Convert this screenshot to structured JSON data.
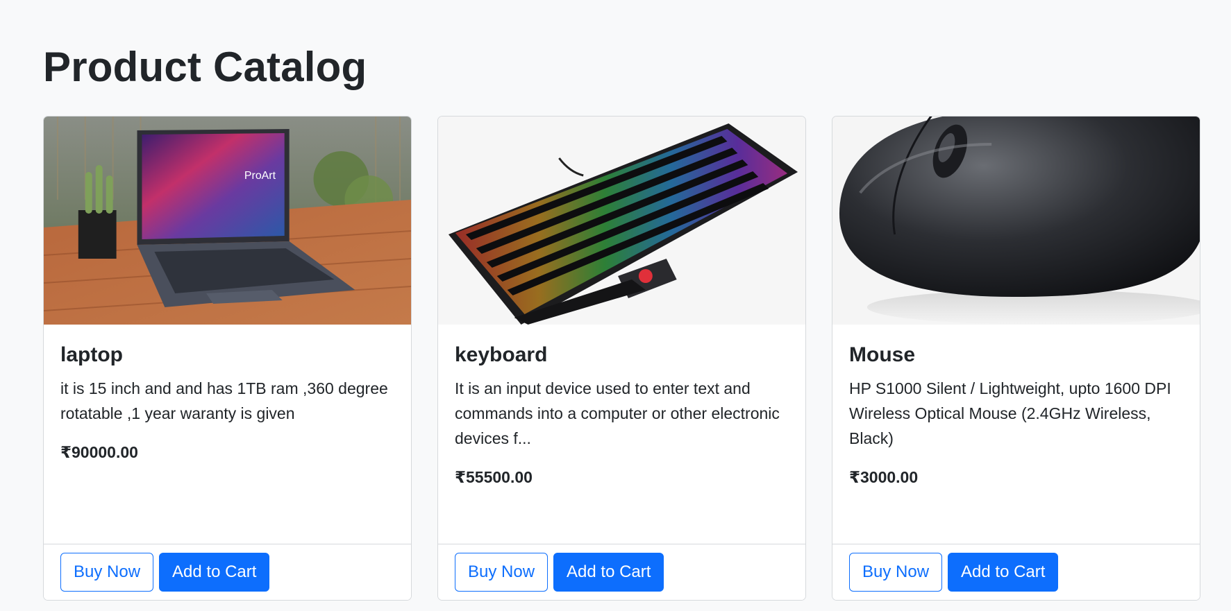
{
  "page": {
    "title": "Product Catalog"
  },
  "colors": {
    "primary": "#0d6efd",
    "background": "#f8f9fa",
    "text": "#212529"
  },
  "products": [
    {
      "name": "laptop",
      "description": "it is 15 inch and and has 1TB ram ,360 degree rotatable ,1 year waranty is given",
      "price": "₹90000.00",
      "image": "laptop-photo",
      "buy_label": "Buy Now",
      "cart_label": "Add to Cart"
    },
    {
      "name": "keyboard",
      "description": "It is an input device used to enter text and commands into a computer or other electronic devices f...",
      "price": "₹55500.00",
      "image": "keyboard-photo",
      "buy_label": "Buy Now",
      "cart_label": "Add to Cart"
    },
    {
      "name": "Mouse",
      "description": "HP S1000 Silent / Lightweight, upto 1600 DPI Wireless Optical Mouse (2.4GHz Wireless, Black)",
      "price": "₹3000.00",
      "image": "mouse-photo",
      "buy_label": "Buy Now",
      "cart_label": "Add to Cart"
    }
  ]
}
